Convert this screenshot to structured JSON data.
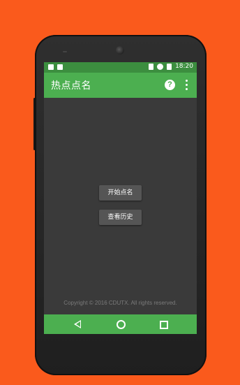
{
  "app": {
    "title": "热点点名"
  },
  "status_bar": {
    "time": "18:20",
    "icons": [
      "image-icon",
      "android-icon",
      "vibrate-icon",
      "alarm-icon",
      "battery-icon"
    ]
  },
  "toolbar": {
    "help_icon": "help-icon",
    "help_glyph": "?",
    "overflow_icon": "more-vert-icon"
  },
  "main": {
    "start_button_label": "开始点名",
    "history_button_label": "查看历史",
    "copyright": "Copyright © 2016 CDUTX. All rights reserved."
  },
  "nav": {
    "back": "back-icon",
    "home": "home-icon",
    "recent": "recent-apps-icon"
  },
  "colors": {
    "background": "#fa5a1c",
    "primary": "#4caf50",
    "primary_dark": "#3c8e3f",
    "screen_bg": "#3a3a3a",
    "button_bg": "#555555"
  }
}
